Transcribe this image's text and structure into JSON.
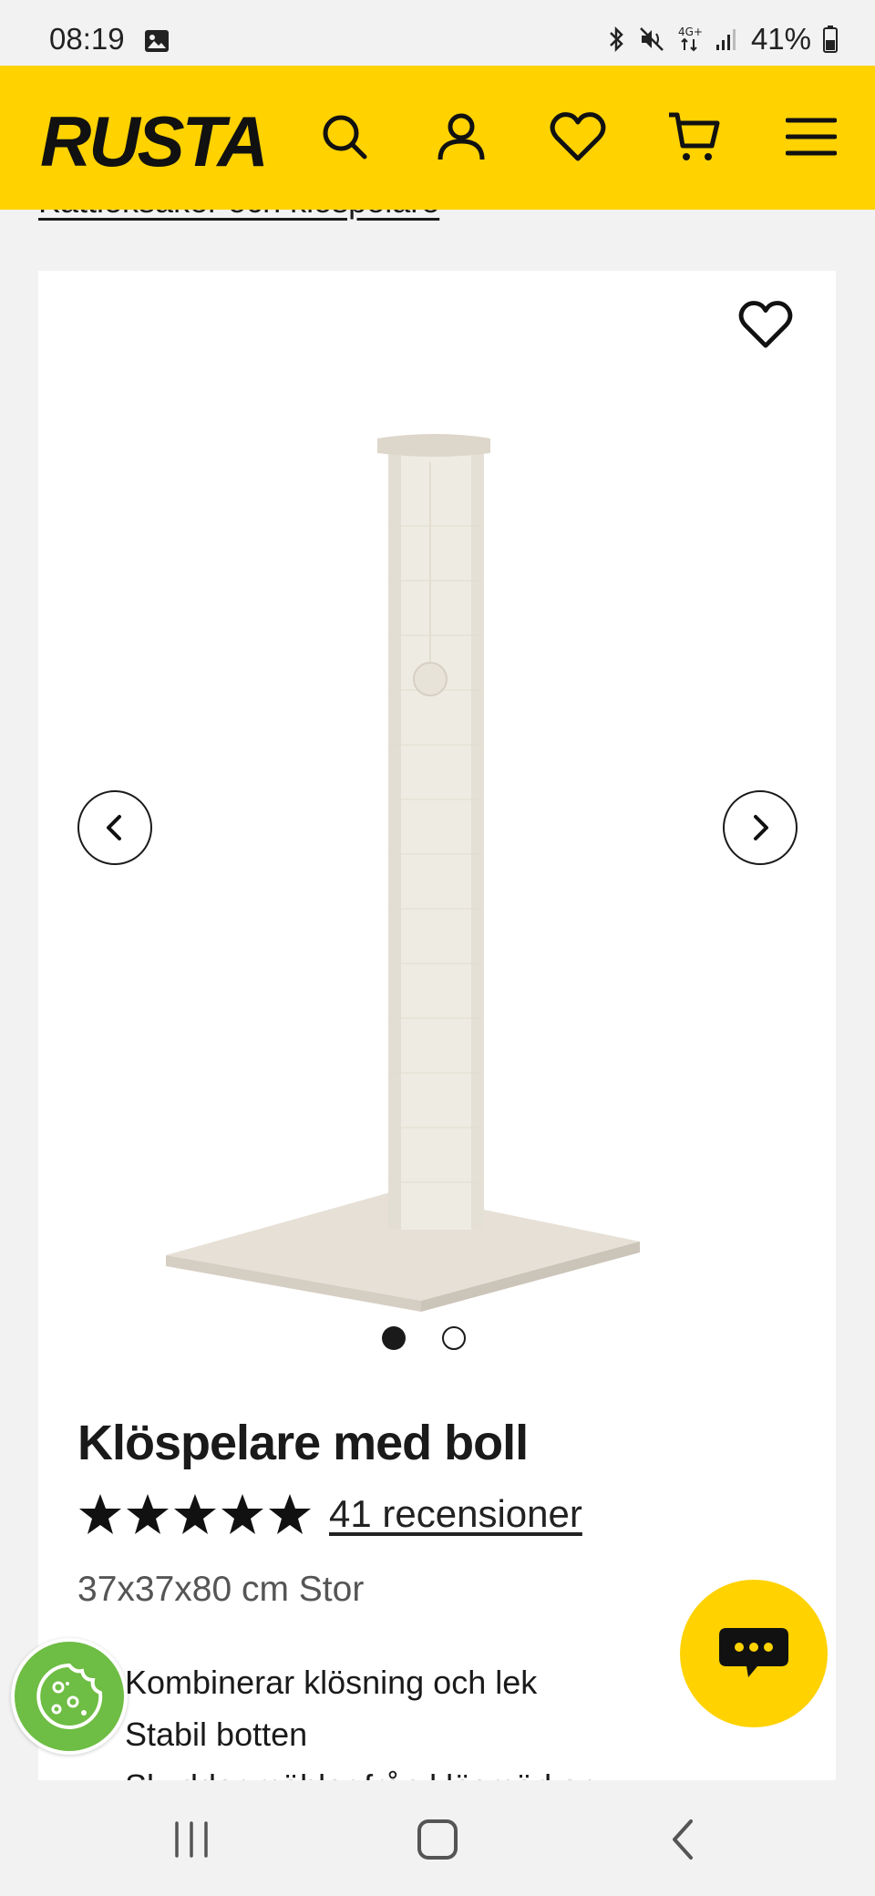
{
  "status_bar": {
    "time": "08:19",
    "battery": "41%",
    "icons": [
      "gallery-icon",
      "bluetooth-icon",
      "mute-icon",
      "4g-icon",
      "signal-icon",
      "battery-icon"
    ]
  },
  "header": {
    "logo": "RUSTA",
    "brand_color": "#ffd200",
    "icons": [
      "search-icon",
      "account-icon",
      "heart-icon",
      "cart-icon",
      "menu-icon"
    ]
  },
  "breadcrumb": {
    "label": "Kattleksaker och klöspelare"
  },
  "product": {
    "title": "Klöspelare med boll",
    "rating_stars": 5,
    "reviews_label": "41 recensioner",
    "variant": "37x37x80 cm Stor",
    "image_index": 1,
    "image_count": 2,
    "features": [
      "Kombinerar klösning och lek",
      "Stabil botten",
      "Skyddar möbler från klösmärken"
    ]
  },
  "floating": {
    "chat_icon": "chat-icon",
    "cookie_icon": "cookie-icon",
    "cookie_color": "#6ebd44"
  },
  "nav_bar": {
    "icons": [
      "recent-apps-icon",
      "home-icon",
      "back-icon"
    ]
  }
}
